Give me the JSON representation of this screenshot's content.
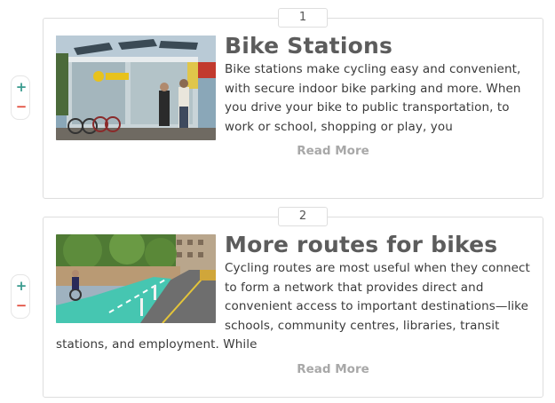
{
  "items": [
    {
      "number": "1",
      "title": "Bike Stations",
      "description": "Bike stations make cycling easy and convenient, with secure indoor bike parking and more. When you drive your bike to public transportation, to work or school, shopping or play, you",
      "read_more": "Read More",
      "add_symbol": "+",
      "remove_symbol": "−"
    },
    {
      "number": "2",
      "title": "More routes for bikes",
      "description": "Cycling routes are most useful when they connect to form a network that provides direct and convenient access to important destinations—like schools, community centres, libraries, transit stations, and employment. While",
      "read_more": "Read More",
      "add_symbol": "+",
      "remove_symbol": "−"
    }
  ],
  "colors": {
    "add": "#3a9b8e",
    "remove": "#e04a3a",
    "title": "#5c5c5c",
    "read_more": "#a8a8a8"
  }
}
